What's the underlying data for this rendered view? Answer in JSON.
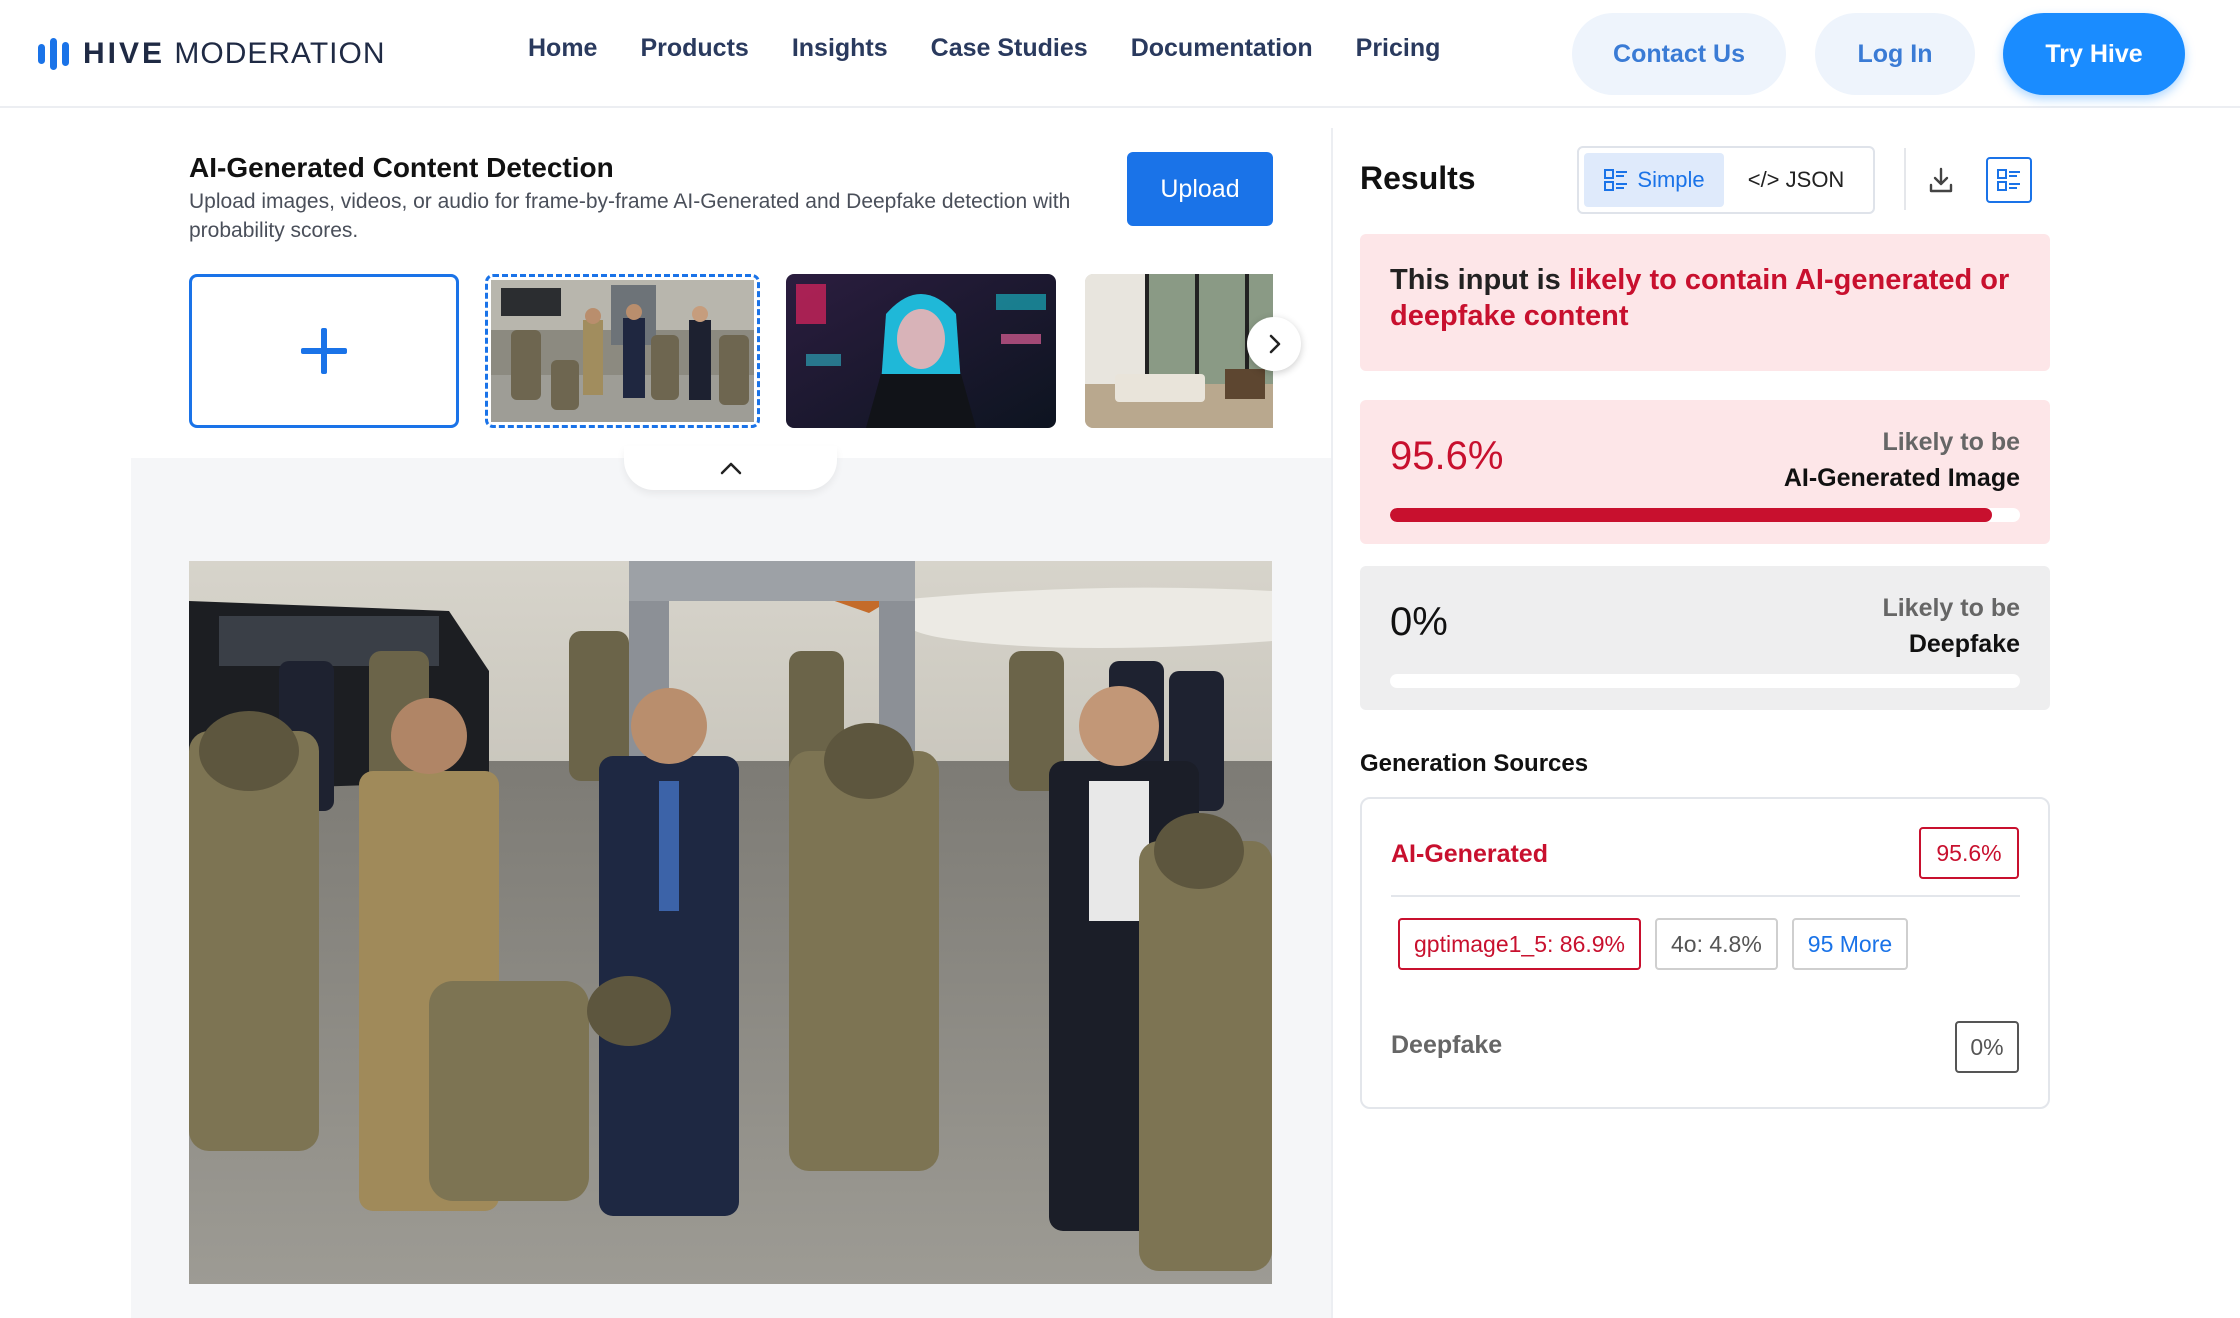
{
  "nav": {
    "logo_strong": "HIVE",
    "logo_light": "MODERATION",
    "links": [
      "Home",
      "Products",
      "Insights",
      "Case Studies",
      "Documentation",
      "Pricing"
    ],
    "contact_label": "Contact Us",
    "login_label": "Log In",
    "try_label": "Try Hive",
    "accent": "#1a8cff"
  },
  "detector": {
    "title": "AI-Generated Content Detection",
    "description": "Upload images, videos, or audio for frame-by-frame AI-Generated and Deepfake detection with probability scores.",
    "upload_label": "Upload"
  },
  "results": {
    "title": "Results",
    "view_simple": "Simple",
    "view_json": "</> JSON",
    "alert_prefix": "This input is ",
    "alert_highlight": "likely to contain AI-generated or deepfake content",
    "scores": [
      {
        "pct": "95.6%",
        "fraction": 0.956,
        "line1": "Likely to be",
        "line2": "AI-Generated Image",
        "color": "#c8102e"
      },
      {
        "pct": "0%",
        "fraction": 0,
        "line1": "Likely to be",
        "line2": "Deepfake",
        "color": "#c8102e"
      }
    ],
    "generation_sources": {
      "title": "Generation Sources",
      "ai_label": "AI-Generated",
      "ai_value": "95.6%",
      "chips": [
        "gptimage1_5: 86.9%",
        "4o: 4.8%",
        "95 More"
      ],
      "deepfake_label": "Deepfake",
      "deepfake_value": "0%"
    }
  }
}
